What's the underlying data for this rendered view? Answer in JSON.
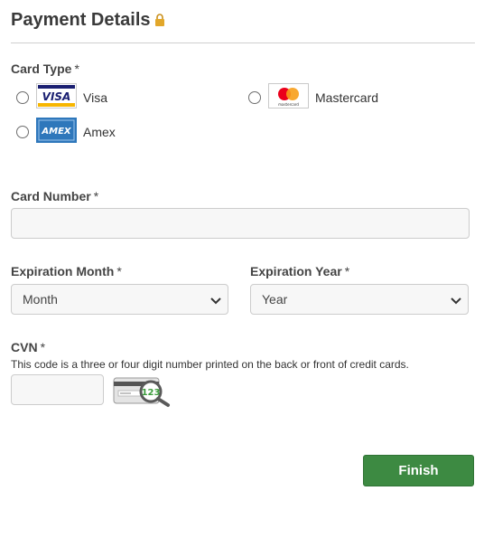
{
  "header": {
    "title": "Payment Details"
  },
  "card_type": {
    "label": "Card Type",
    "required_mark": "*",
    "options": [
      {
        "logo_text": "VISA",
        "name": "Visa",
        "selected": false
      },
      {
        "logo_text": "mastercard",
        "name": "Mastercard",
        "selected": false
      },
      {
        "logo_text": "AMEX",
        "name": "Amex",
        "selected": false
      }
    ]
  },
  "card_number": {
    "label": "Card Number",
    "required_mark": "*",
    "value": ""
  },
  "expiration_month": {
    "label": "Expiration Month",
    "required_mark": "*",
    "selected": "Month"
  },
  "expiration_year": {
    "label": "Expiration Year",
    "required_mark": "*",
    "selected": "Year"
  },
  "cvn": {
    "label": "CVN",
    "required_mark": "*",
    "help": "This code is a three or four digit number printed on the back or front of credit cards.",
    "value": "",
    "example_digits": "123"
  },
  "actions": {
    "finish_label": "Finish"
  },
  "colors": {
    "finish_button": "#3d8a42",
    "lock": "#e2a72a",
    "visa_blue": "#1a1f71",
    "visa_gold": "#f7b600",
    "mc_red": "#eb001b",
    "mc_orange": "#f79e1b",
    "amex_blue": "#2e77bb"
  }
}
